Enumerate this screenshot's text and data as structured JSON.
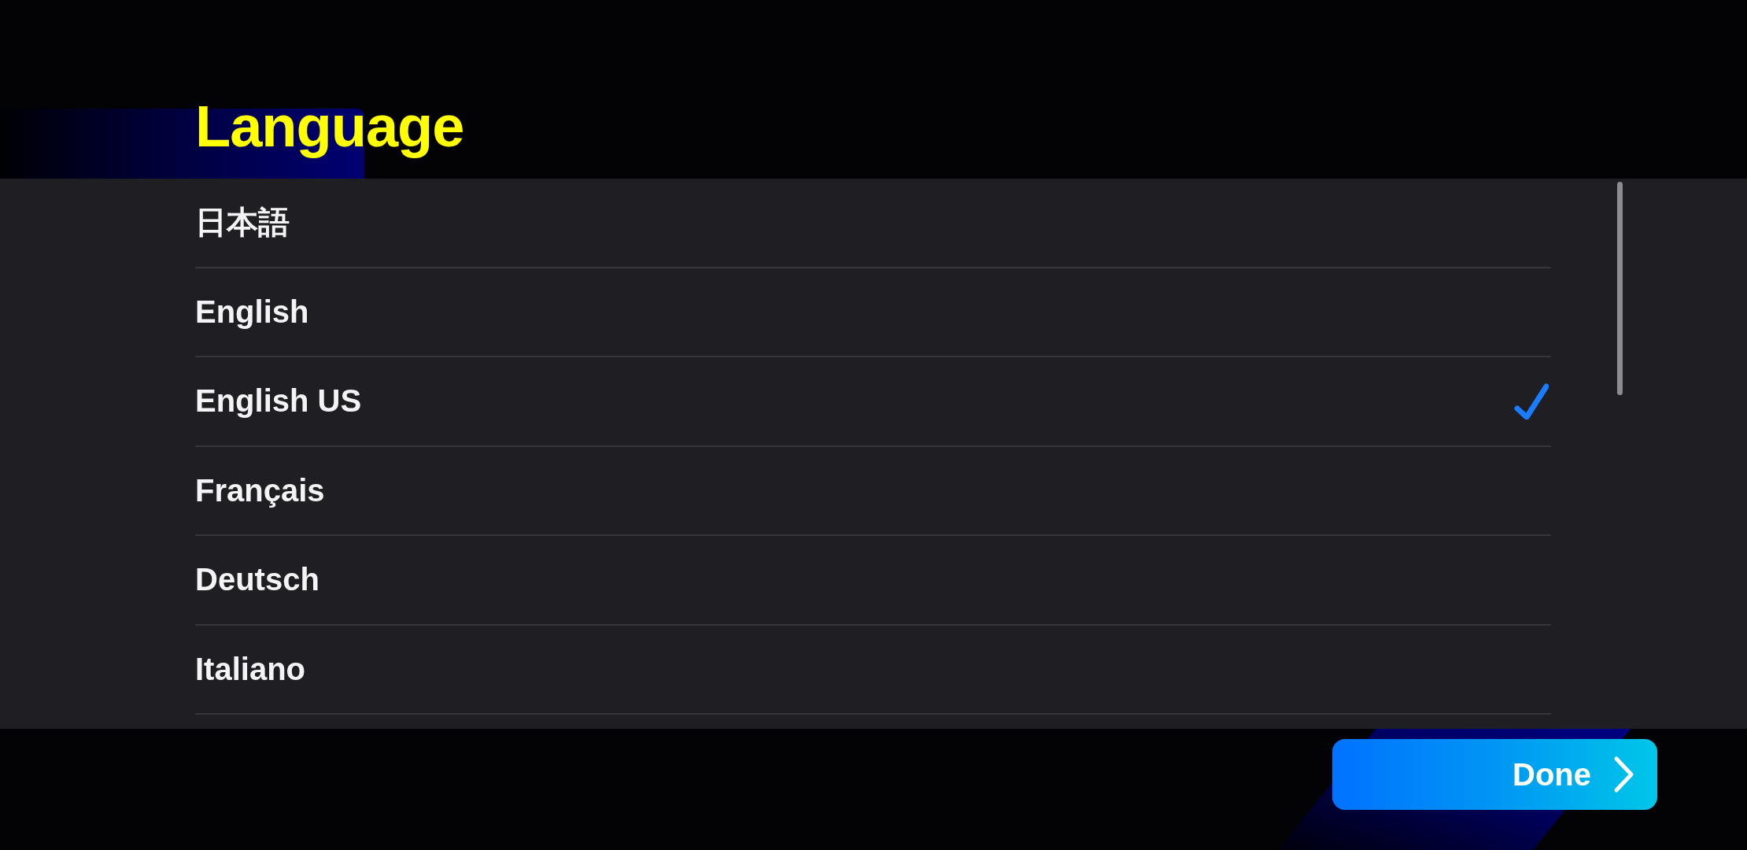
{
  "title": "Language",
  "languages": [
    {
      "label": "日本語",
      "selected": false
    },
    {
      "label": "English",
      "selected": false
    },
    {
      "label": "English US",
      "selected": true
    },
    {
      "label": "Français",
      "selected": false
    },
    {
      "label": "Deutsch",
      "selected": false
    },
    {
      "label": "Italiano",
      "selected": false
    }
  ],
  "done_button": {
    "label": "Done"
  }
}
